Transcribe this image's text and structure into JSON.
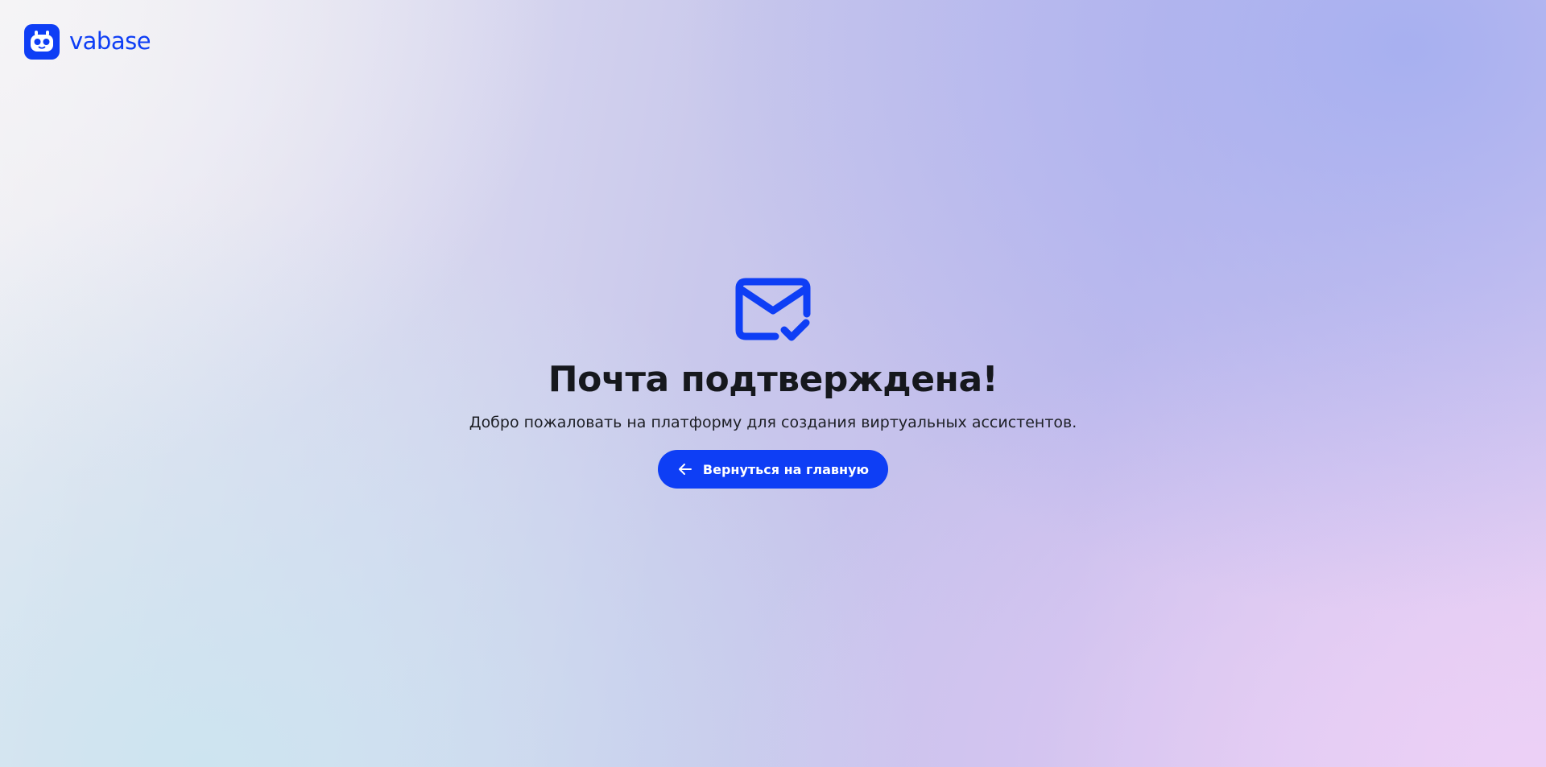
{
  "brand": {
    "name": "vabase",
    "color": "#0e3ef5"
  },
  "confirmation": {
    "icon": "mail-check-icon",
    "title": "Почта подтверждена!",
    "subtitle": "Добро пожаловать на платформу для создания виртуальных ассистентов.",
    "back_button": {
      "label": "Вернуться на главную",
      "icon": "arrow-left-icon"
    }
  },
  "colors": {
    "accent": "#0e3ef5",
    "text": "#16181d"
  }
}
